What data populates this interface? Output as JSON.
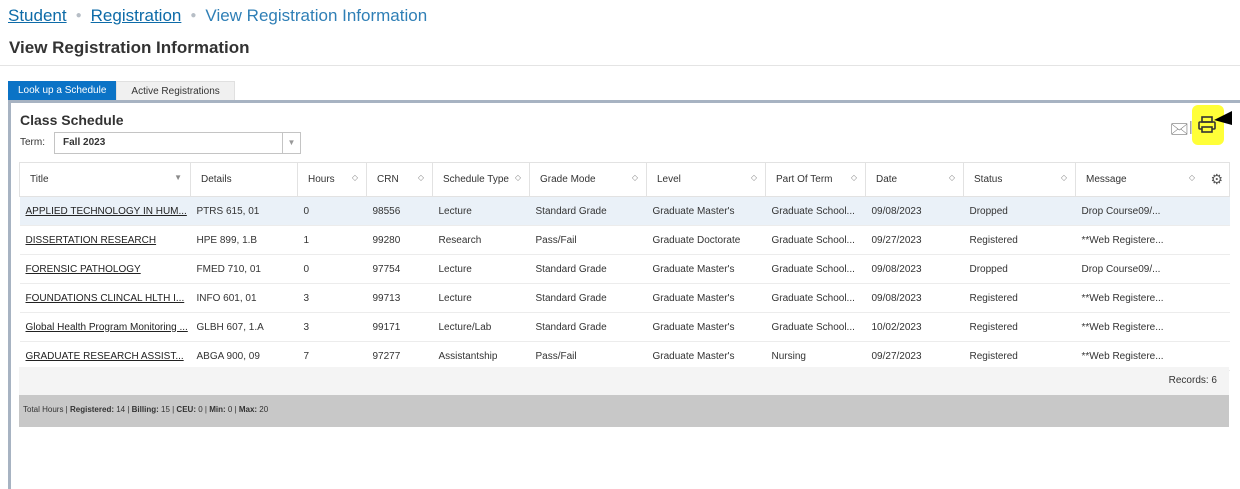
{
  "breadcrumb": {
    "student": "Student",
    "registration": "Registration",
    "current": "View Registration Information"
  },
  "page_title": "View Registration Information",
  "tabs": [
    {
      "label": "Look up a Schedule",
      "active": true
    },
    {
      "label": "Active Registrations",
      "active": false
    }
  ],
  "section": {
    "title": "Class Schedule",
    "term_label": "Term:",
    "term_value": "Fall 2023"
  },
  "icons": {
    "email": "email-icon",
    "print": "print-icon",
    "highlight_color": "#ffff38"
  },
  "table": {
    "columns": [
      "Title",
      "Details",
      "Hours",
      "CRN",
      "Schedule Type",
      "Grade Mode",
      "Level",
      "Part Of Term",
      "Date",
      "Status",
      "Message"
    ],
    "rows": [
      [
        "APPLIED TECHNOLOGY IN HUM...",
        "PTRS 615, 01",
        "0",
        "98556",
        "Lecture",
        "Standard Grade",
        "Graduate Master's",
        "Graduate School...",
        "09/08/2023",
        "Dropped",
        "Drop Course09/..."
      ],
      [
        "DISSERTATION RESEARCH",
        "HPE 899, 1.B",
        "1",
        "99280",
        "Research",
        "Pass/Fail",
        "Graduate Doctorate",
        "Graduate School...",
        "09/27/2023",
        "Registered",
        "**Web Registere..."
      ],
      [
        "FORENSIC PATHOLOGY",
        "FMED 710, 01",
        "0",
        "97754",
        "Lecture",
        "Standard Grade",
        "Graduate Master's",
        "Graduate School...",
        "09/08/2023",
        "Dropped",
        "Drop Course09/..."
      ],
      [
        "FOUNDATIONS CLINCAL HLTH I...",
        "INFO 601, 01",
        "3",
        "99713",
        "Lecture",
        "Standard Grade",
        "Graduate Master's",
        "Graduate School...",
        "09/08/2023",
        "Registered",
        "**Web Registere..."
      ],
      [
        "Global Health Program Monitoring ...",
        "GLBH 607, 1.A",
        "3",
        "99171",
        "Lecture/Lab",
        "Standard Grade",
        "Graduate Master's",
        "Graduate School...",
        "10/02/2023",
        "Registered",
        "**Web Registere..."
      ],
      [
        "GRADUATE RESEARCH ASSIST...",
        "ABGA 900, 09",
        "7",
        "97277",
        "Assistantship",
        "Pass/Fail",
        "Graduate Master's",
        "Nursing",
        "09/27/2023",
        "Registered",
        "**Web Registere..."
      ]
    ]
  },
  "records": "Records: 6",
  "totals": {
    "prefix": "Total Hours | ",
    "registered_label": "Registered:",
    "registered_value": " 14 | ",
    "billing_label": "Billing:",
    "billing_value": " 15 | ",
    "ceu_label": "CEU:",
    "ceu_value": " 0 | ",
    "min_label": "Min:",
    "min_value": " 0 | ",
    "max_label": "Max:",
    "max_value": " 20"
  }
}
